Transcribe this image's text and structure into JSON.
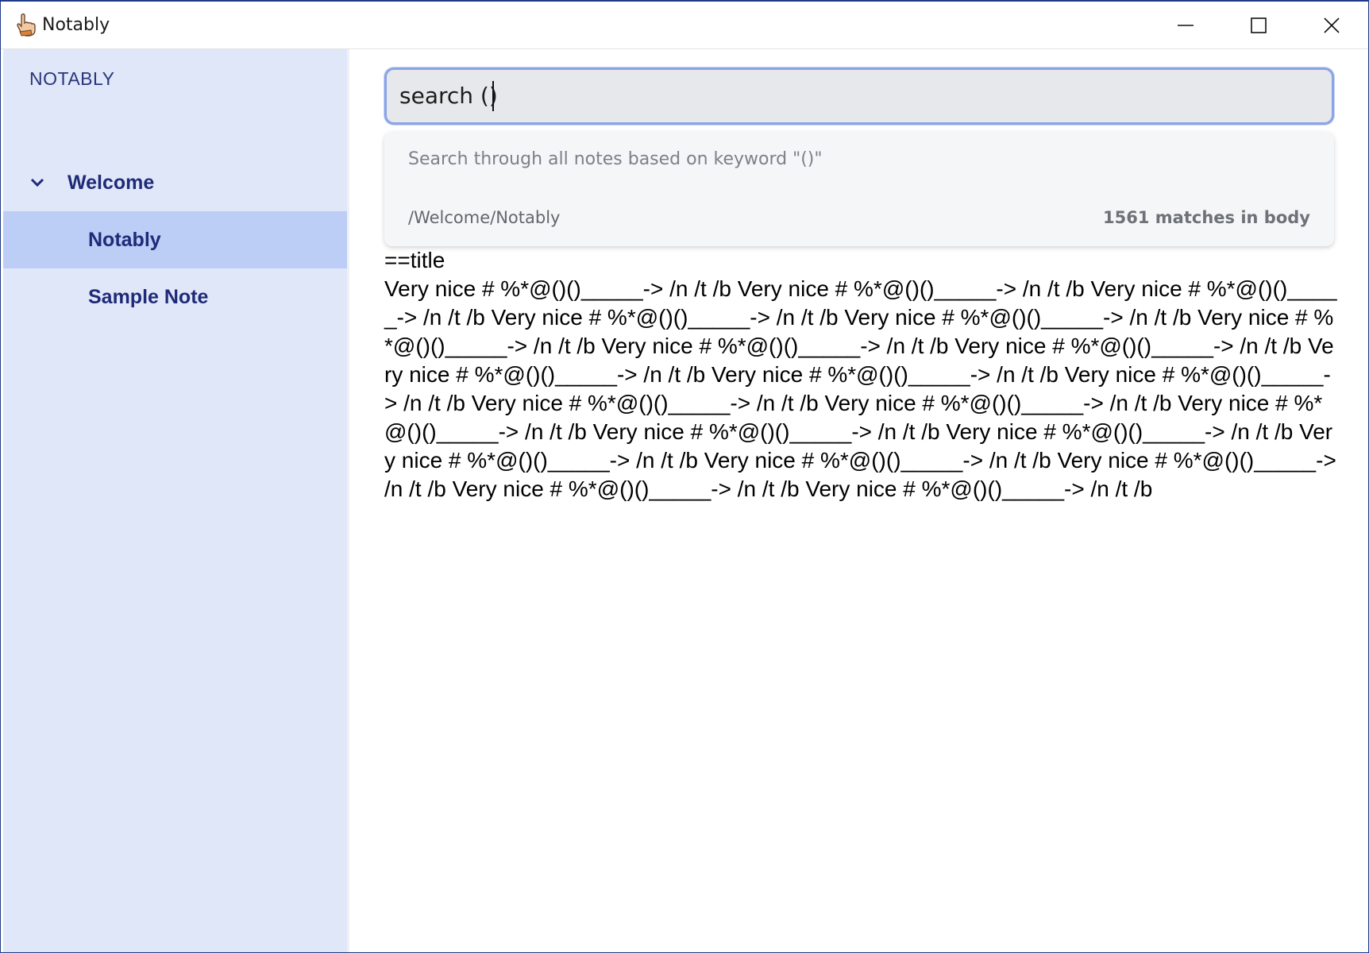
{
  "window": {
    "title": "Notably",
    "app_icon": "hand-pointer-icon",
    "controls": {
      "minimize_icon": "minimize-icon",
      "maximize_icon": "maximize-icon",
      "close_icon": "close-icon"
    }
  },
  "sidebar": {
    "heading": "NOTABLY",
    "items": [
      {
        "label": "Welcome",
        "icon": "chevron-down-icon",
        "expanded": true,
        "level": 0,
        "active": false
      },
      {
        "label": "Notably",
        "level": 1,
        "active": true
      },
      {
        "label": "Sample Note",
        "level": 1,
        "active": false
      }
    ],
    "colors": {
      "background": "#e0e7f9",
      "active": "#bccdf6",
      "text": "#1f2a78"
    }
  },
  "search": {
    "value": "search ()",
    "dropdown": {
      "hint": "Search through all notes based on keyword \"()\"",
      "result_path": "/Welcome/Notably",
      "result_count": "1561 matches in body"
    }
  },
  "note": {
    "title_line": "==title",
    "body": "Very nice # %*@()()_____-> /n /t /b Very nice # %*@()()_____-> /n /t /b Very nice # %*@()()_____-> /n /t /b Very nice # %*@()()_____-> /n /t /b Very nice # %*@()()_____-> /n /t /b Very nice # %*@()()_____-> /n /t /b Very nice # %*@()()_____-> /n /t /b Very nice # %*@()()_____-> /n /t /b Very nice # %*@()()_____-> /n /t /b Very nice # %*@()()_____-> /n /t /b Very nice # %*@()()_____-> /n /t /b Very nice # %*@()()_____-> /n /t /b Very nice # %*@()()_____-> /n /t /b Very nice # %*@()()_____-> /n /t /b Very nice # %*@()()_____-> /n /t /b Very nice # %*@()()_____-> /n /t /b Very nice # %*@()()_____-> /n /t /b Very nice # %*@()()_____-> /n /t /b Very nice # %*@()()_____-> /n /t /b Very nice # %*@()()_____-> /n /t /b Very nice # %*@()()_____-> /n /t /b"
  }
}
